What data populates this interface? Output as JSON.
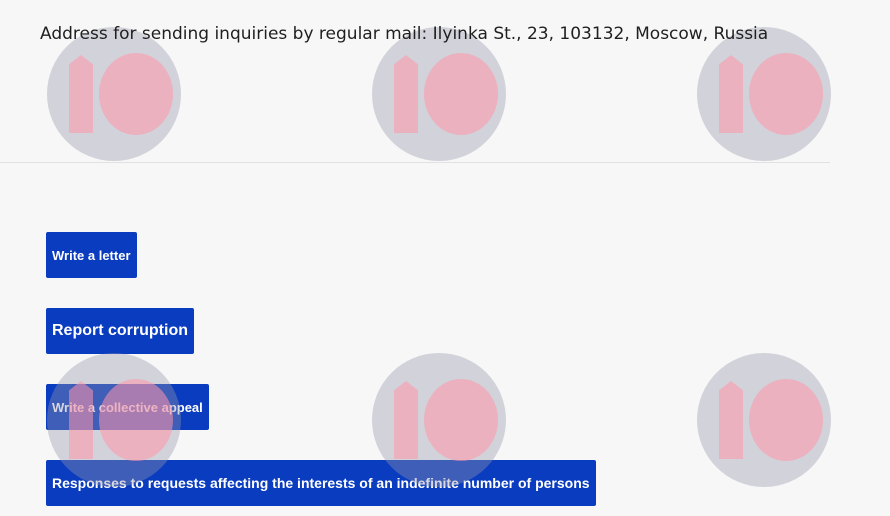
{
  "contact": {
    "address_text": "Address for sending inquiries by regular mail: Ilyinka St., 23, 103132, Moscow, Russia"
  },
  "actions": [
    {
      "label": "Write a letter"
    },
    {
      "label": "Report corruption"
    },
    {
      "label": "Write a collective appeal"
    },
    {
      "label": "Responses to requests affecting the interests of an indefinite number of persons"
    }
  ],
  "colors": {
    "button_background": "#0a3cc0",
    "button_text": "#ffffff",
    "page_background": "#f7f7f7"
  }
}
